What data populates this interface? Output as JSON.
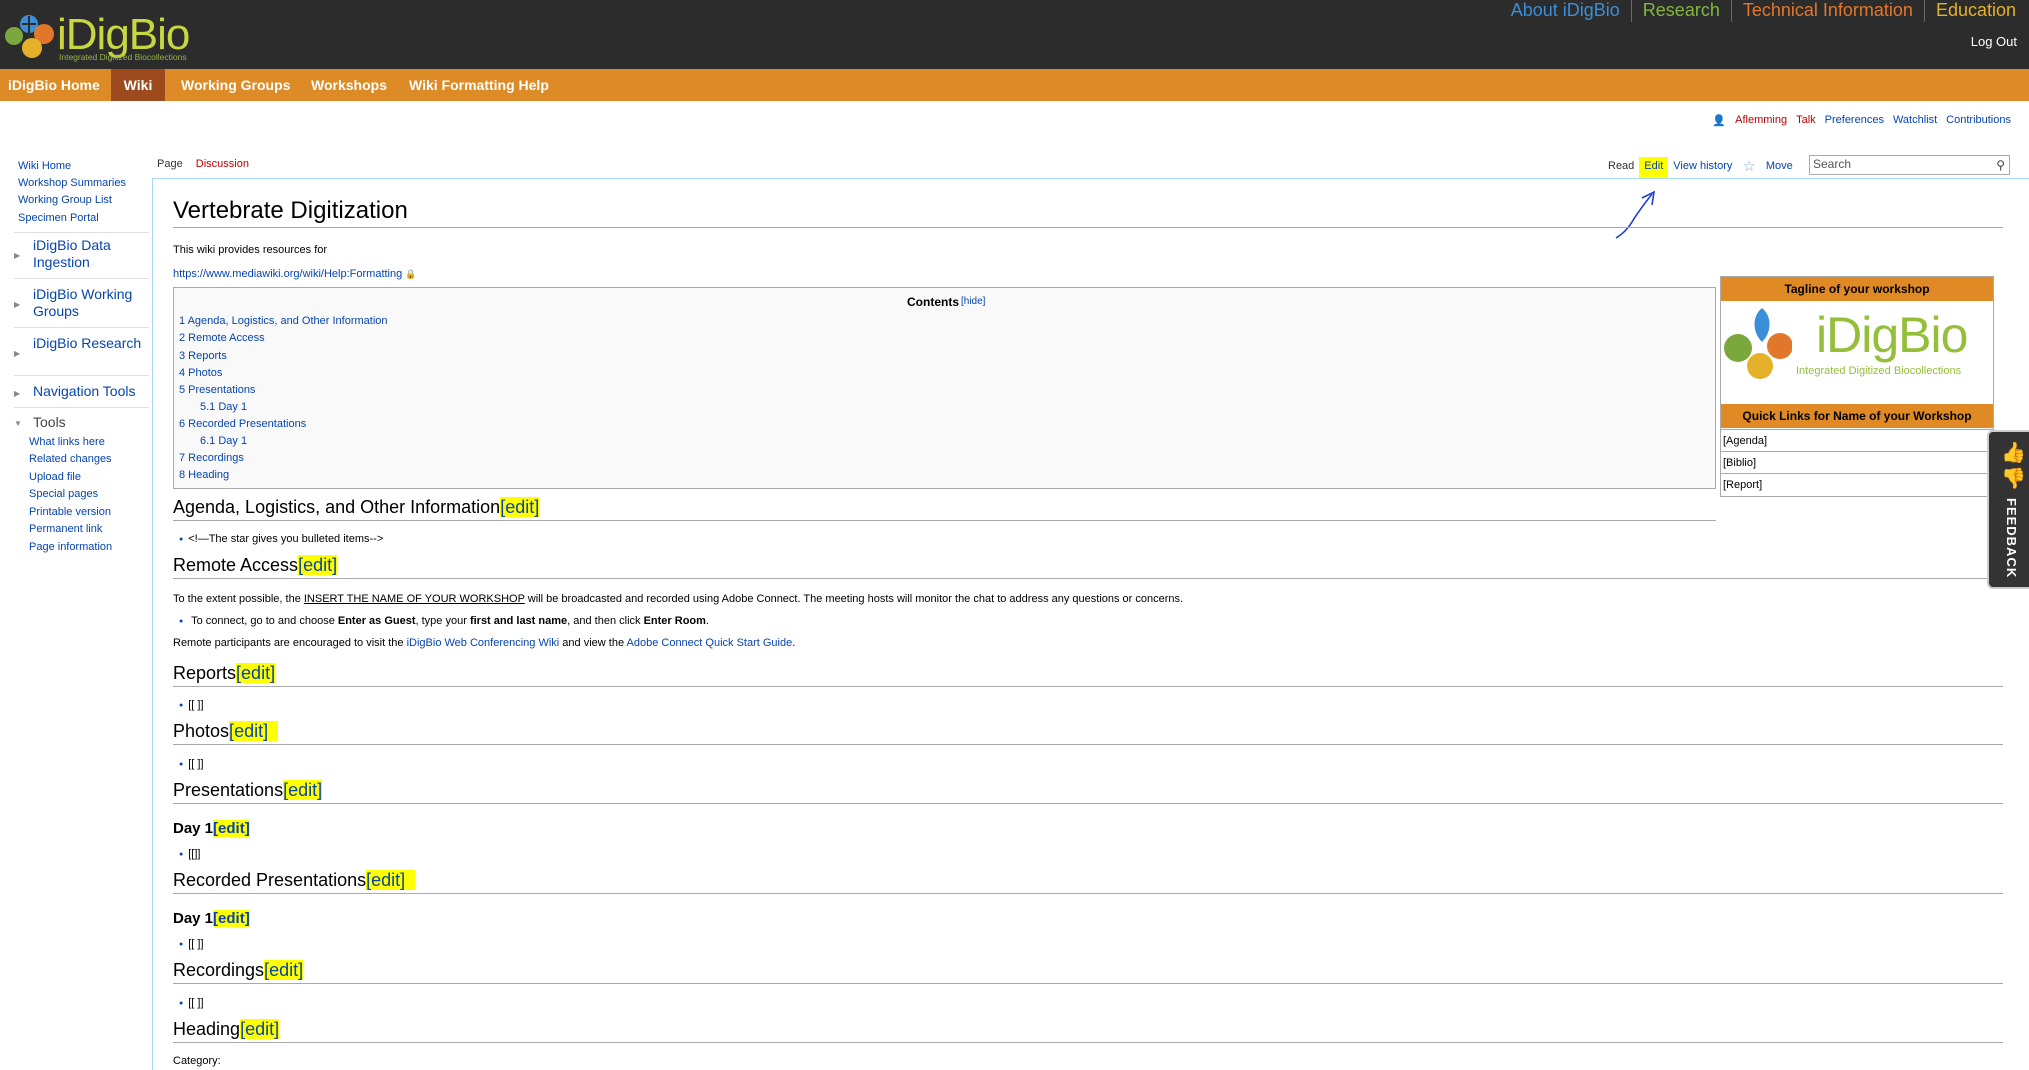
{
  "site": {
    "logo_text": "iDigBio",
    "logo_subtitle": "Integrated Digitized Biocollections",
    "top_nav": [
      {
        "label": "About iDigBio",
        "color": "#3a8fd8"
      },
      {
        "label": "Research",
        "color": "#82b641"
      },
      {
        "label": "Technical Information",
        "color": "#e2772c"
      },
      {
        "label": "Education",
        "color": "#e6b12a"
      }
    ],
    "logout": "Log Out"
  },
  "main_nav": [
    {
      "label": "iDigBio Home"
    },
    {
      "label": "Wiki",
      "active": true
    },
    {
      "label": "Working Groups"
    },
    {
      "label": "Workshops"
    },
    {
      "label": "Wiki Formatting Help"
    }
  ],
  "personal": {
    "user": "Aflemming",
    "talk": "Talk",
    "preferences": "Preferences",
    "watchlist": "Watchlist",
    "contributions": "Contributions"
  },
  "sidebar": {
    "links": [
      "Wiki Home",
      "Workshop Summaries",
      "Working Group List",
      "Specimen Portal"
    ],
    "portals": [
      "iDigBio Data Ingestion",
      "iDigBio Working Groups",
      "iDigBio Research",
      "Navigation Tools"
    ],
    "tools_label": "Tools",
    "tools": [
      "What links here",
      "Related changes",
      "Upload file",
      "Special pages",
      "Printable version",
      "Permanent link",
      "Page information"
    ]
  },
  "tabs": {
    "page": "Page",
    "discussion": "Discussion",
    "read": "Read",
    "edit": "Edit",
    "history": "View history",
    "move": "Move",
    "search_placeholder": "Search"
  },
  "article": {
    "title": "Vertebrate Digitization",
    "intro": "This wiki provides resources for",
    "intro_link": "https://www.mediawiki.org/wiki/Help:Formatting",
    "toc_title": "Contents",
    "toc_hide": "[hide]",
    "toc": [
      {
        "text": "1 Agenda, Logistics, and Other Information"
      },
      {
        "text": "2 Remote Access"
      },
      {
        "text": "3 Reports"
      },
      {
        "text": "4 Photos"
      },
      {
        "text": "5 Presentations"
      },
      {
        "text": "5.1 Day 1"
      },
      {
        "text": "6 Recorded Presentations"
      },
      {
        "text": "6.1 Day 1"
      },
      {
        "text": "7 Recordings"
      },
      {
        "text": "8 Heading"
      }
    ],
    "edit_label": "edit",
    "h_agenda": "Agenda, Logistics, and Other Information",
    "agenda_bullet": "<!—The star gives you bulleted items-->",
    "h_remote": "Remote Access",
    "remote_text_1": "To the extent possible, the",
    "remote_insert": "INSERT THE NAME OF YOUR WORKSHOP",
    "remote_text_2": "will be broadcasted and recorded using Adobe Connect. The meeting hosts will monitor the chat to address any questions or concerns.",
    "remote_bullet_1": "To connect, go to and choose",
    "remote_bullet_guest": "Enter as Guest",
    "remote_bullet_2": ", type your",
    "remote_bullet_name": "first and last name",
    "remote_bullet_3": ", and then click",
    "remote_bullet_enter": "Enter Room",
    "remote_bullet_4": ".",
    "remote_participants_1": "Remote participants are encouraged to visit the",
    "remote_wiki_link": "iDigBio Web Conferencing Wiki",
    "remote_participants_2": "and view the",
    "remote_guide_link": "Adobe Connect Quick Start Guide",
    "remote_participants_3": ".",
    "h_reports": "Reports",
    "reports_bullet": "[[ ]]",
    "h_photos": "Photos",
    "photos_bullet": "[[ ]]",
    "h_presentations": "Presentations",
    "h_day1": "Day 1",
    "day1_bullet": "[[]]",
    "h_recorded": "Recorded Presentations",
    "h_day1b": "Day 1",
    "day1b_bullet": "[[ ]]",
    "h_recordings": "Recordings",
    "recordings_bullet": "[[ ]]",
    "h_heading": "Heading",
    "category": "Category:"
  },
  "infobox": {
    "tagline": "Tagline of your workshop",
    "logo_text": "iDigBio",
    "logo_subtitle": "Integrated Digitized Biocollections",
    "quick_links_title": "Quick Links for Name of your Workshop",
    "links": [
      "[Agenda]",
      "[Biblio]",
      "[Report]"
    ]
  },
  "feedback": "FEEDBACK",
  "colors": {
    "header_bg": "#2c2c2c",
    "orange_bar": "#dd8b27",
    "active_tab": "#9d4a1e",
    "link": "#0645ad",
    "highlight": "#ffff00"
  }
}
